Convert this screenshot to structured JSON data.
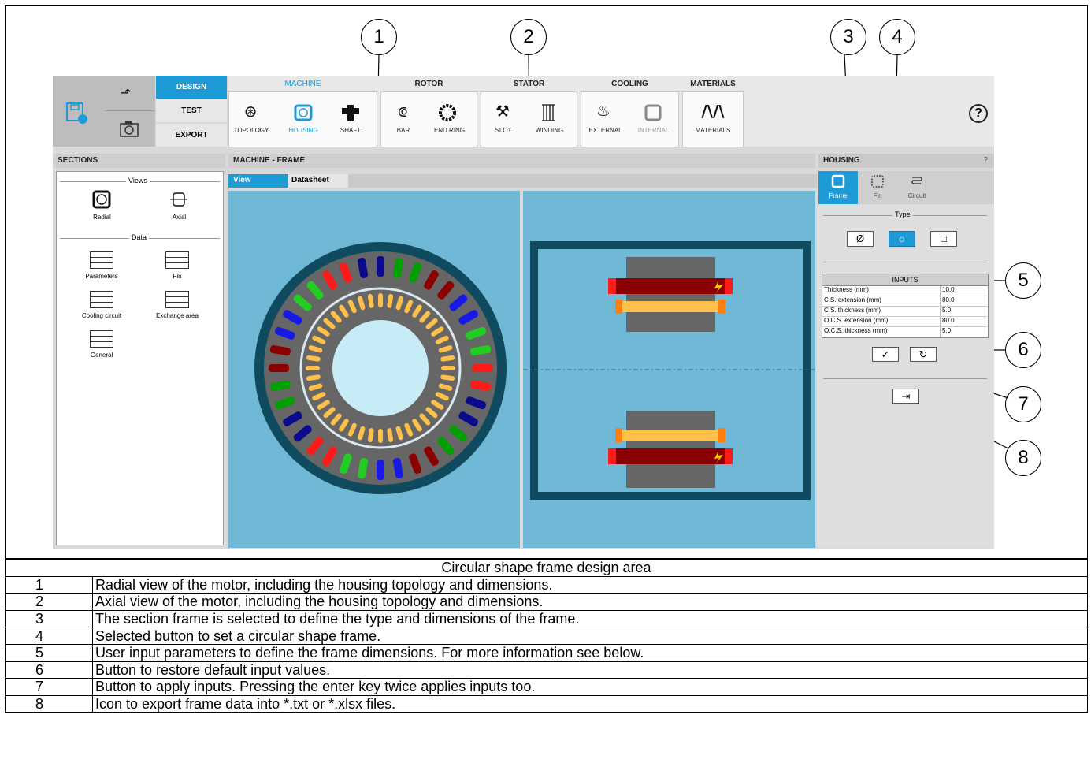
{
  "callouts": [
    "1",
    "2",
    "3",
    "4",
    "5",
    "6",
    "7",
    "8"
  ],
  "menu": {
    "design": "DESIGN",
    "test": "TEST",
    "export": "EXPORT"
  },
  "toolbar": {
    "groups": [
      {
        "title": "MACHINE",
        "items": [
          "TOPOLOGY",
          "HOUSING",
          "SHAFT"
        ]
      },
      {
        "title": "ROTOR",
        "items": [
          "BAR",
          "END RING"
        ]
      },
      {
        "title": "STATOR",
        "items": [
          "SLOT",
          "WINDING"
        ]
      },
      {
        "title": "COOLING",
        "items": [
          "EXTERNAL",
          "INTERNAL"
        ]
      },
      {
        "title": "MATERIALS",
        "items": [
          "MATERIALS"
        ]
      }
    ],
    "help_glyph": "?"
  },
  "sections": {
    "title": "SECTIONS",
    "views_label": "Views",
    "data_label": "Data",
    "radial": "Radial",
    "axial": "Axial",
    "parameters": "Parameters",
    "fin": "Fin",
    "cooling_circuit": "Cooling circuit",
    "exchange_area": "Exchange area",
    "general": "General"
  },
  "main": {
    "title": "MACHINE - FRAME",
    "tab_view": "View",
    "tab_datasheet": "Datasheet"
  },
  "housing": {
    "title": "HOUSING",
    "help": "?",
    "tab_frame": "Frame",
    "tab_fin": "Fin",
    "tab_circuit": "Circuit",
    "type_label": "Type",
    "type_none": "Ø",
    "type_circle": "○",
    "type_square": "□",
    "inputs_title": "INPUTS",
    "inputs": [
      {
        "label": "Thickness (mm)",
        "value": "10.0"
      },
      {
        "label": "C.S. extension (mm)",
        "value": "80.0"
      },
      {
        "label": "C.S. thickness (mm)",
        "value": "5.0"
      },
      {
        "label": "O.C.S. extension (mm)",
        "value": "80.0"
      },
      {
        "label": "O.C.S. thickness (mm)",
        "value": "5.0"
      }
    ],
    "apply_glyph": "✓",
    "reset_glyph": "↻",
    "export_glyph": "⇥"
  },
  "legend": {
    "title": "Circular shape frame design area",
    "rows": [
      {
        "num": "1",
        "text": "Radial view of the motor, including the housing topology and dimensions."
      },
      {
        "num": "2",
        "text": "Axial view of the motor, including the housing topology and dimensions."
      },
      {
        "num": "3",
        "text": "The section frame is selected to define the type and dimensions of the frame."
      },
      {
        "num": "4",
        "text": "Selected button to set a circular shape frame."
      },
      {
        "num": "5",
        "text": "User input parameters to define the frame dimensions. For more information see below."
      },
      {
        "num": "6",
        "text": "Button to restore default input values."
      },
      {
        "num": "7",
        "text": "Button to apply inputs. Pressing the enter key twice applies inputs too."
      },
      {
        "num": "8",
        "text": "Icon to export frame data into *.txt or *.xlsx files."
      }
    ]
  },
  "colors": {
    "accent": "#1e9bd7",
    "view_bg": "#6fb9d6",
    "housing_ring": "#0f4a5e",
    "core": "#666666",
    "bars": "#ffc04a",
    "winding_dark": "#8b0000",
    "ring_shaft": "#c8ecf7"
  }
}
